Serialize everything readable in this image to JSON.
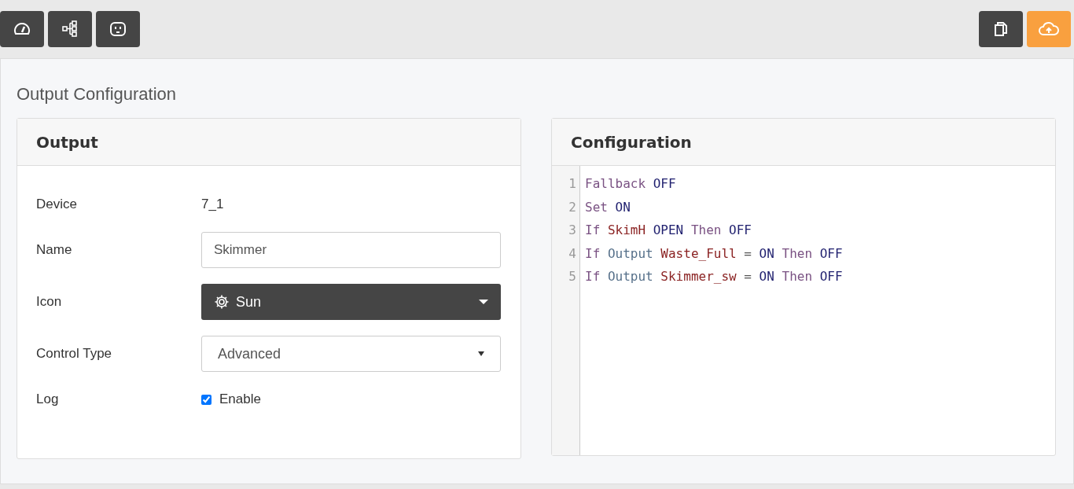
{
  "page_title": "Output Configuration",
  "output_panel": {
    "title": "Output",
    "fields": [
      {
        "kind": "text",
        "label": "Device",
        "value": "7_1"
      },
      {
        "kind": "input",
        "label": "Name",
        "value": "Skimmer"
      },
      {
        "kind": "icon_select",
        "label": "Icon",
        "value": "Sun"
      },
      {
        "kind": "select",
        "label": "Control Type",
        "value": "Advanced"
      },
      {
        "kind": "checkbox",
        "label": "Log",
        "value": "Enable",
        "checked": true
      }
    ]
  },
  "config_panel": {
    "title": "Configuration",
    "lines": [
      {
        "number": "1",
        "tokens": [
          {
            "text": "Fallback",
            "kind": "keyword"
          },
          {
            "text": "OFF",
            "kind": "value"
          }
        ]
      },
      {
        "number": "2",
        "tokens": [
          {
            "text": "Set",
            "kind": "keyword"
          },
          {
            "text": "ON",
            "kind": "value"
          }
        ]
      },
      {
        "number": "3",
        "tokens": [
          {
            "text": "If",
            "kind": "keyword"
          },
          {
            "text": "SkimH",
            "kind": "ident"
          },
          {
            "text": "OPEN",
            "kind": "value"
          },
          {
            "text": "Then",
            "kind": "keyword"
          },
          {
            "text": "OFF",
            "kind": "value"
          }
        ]
      },
      {
        "number": "4",
        "tokens": [
          {
            "text": "If",
            "kind": "keyword"
          },
          {
            "text": "Output",
            "kind": "type"
          },
          {
            "text": "Waste_Full",
            "kind": "ident"
          },
          {
            "text": "=",
            "kind": "operator"
          },
          {
            "text": "ON",
            "kind": "value"
          },
          {
            "text": "Then",
            "kind": "keyword"
          },
          {
            "text": "OFF",
            "kind": "value"
          }
        ]
      },
      {
        "number": "5",
        "tokens": [
          {
            "text": "If",
            "kind": "keyword"
          },
          {
            "text": "Output",
            "kind": "type"
          },
          {
            "text": "Skimmer_sw",
            "kind": "ident"
          },
          {
            "text": "=",
            "kind": "operator"
          },
          {
            "text": "ON",
            "kind": "value"
          },
          {
            "text": "Then",
            "kind": "keyword"
          },
          {
            "text": "OFF",
            "kind": "value"
          }
        ]
      }
    ]
  }
}
